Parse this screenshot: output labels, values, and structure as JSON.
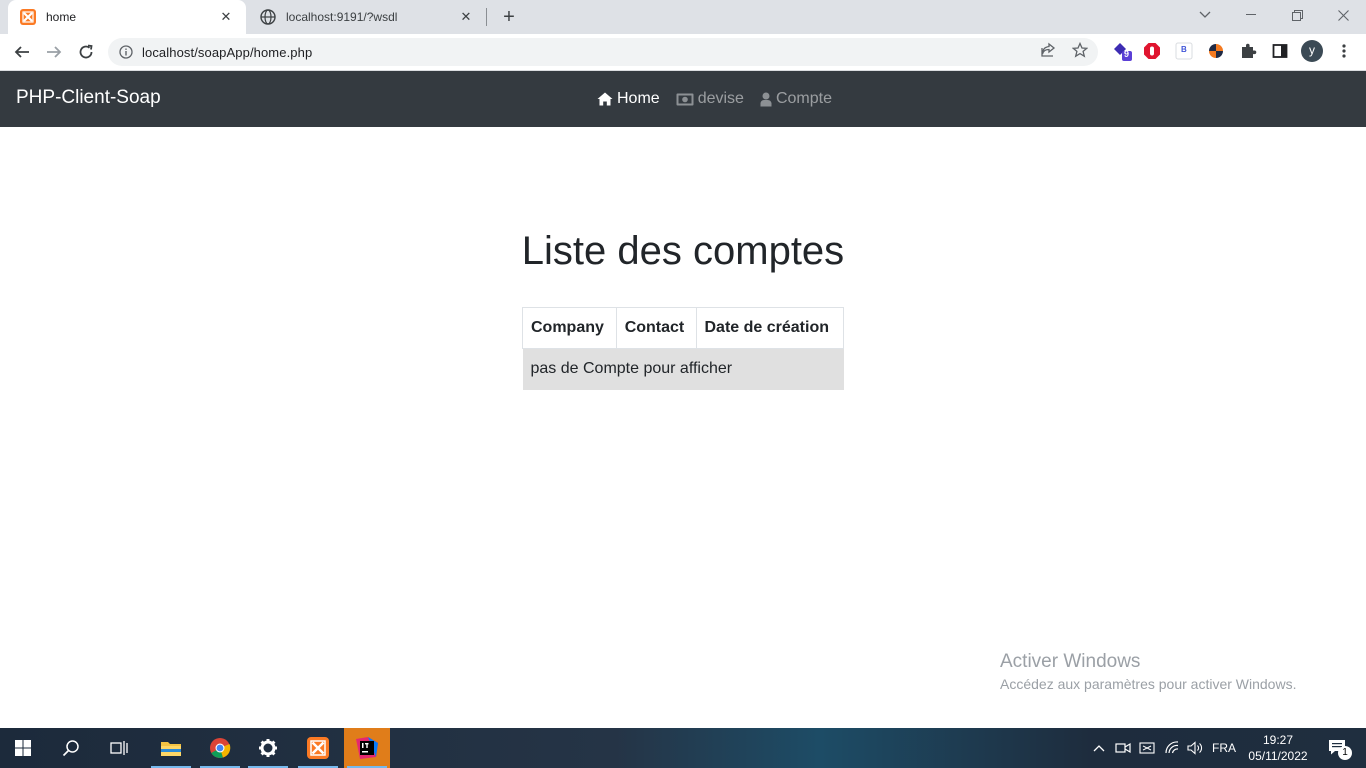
{
  "browser": {
    "tabs": [
      {
        "title": "home",
        "active": true
      },
      {
        "title": "localhost:9191/?wsdl",
        "active": false
      }
    ],
    "url": "localhost/soapApp/home.php",
    "profile_initial": "y",
    "extension_badge": "9",
    "extension_b_label": "B"
  },
  "navbar": {
    "brand": "PHP-Client-Soap",
    "links": [
      {
        "label": "Home",
        "icon": "home-icon",
        "active": true
      },
      {
        "label": "devise",
        "icon": "money-icon",
        "active": false
      },
      {
        "label": "Compte",
        "icon": "user-icon",
        "active": false
      }
    ]
  },
  "main": {
    "title": "Liste des comptes",
    "table": {
      "headers": [
        "Company",
        "Contact",
        "Date de création"
      ],
      "empty_message": "pas de Compte pour afficher"
    }
  },
  "watermark": {
    "title": "Activer Windows",
    "subtitle": "Accédez aux paramètres pour activer Windows."
  },
  "taskbar": {
    "apps": [
      "start-icon",
      "search-icon",
      "task-view-icon",
      "file-explorer-icon",
      "chrome-icon",
      "settings-icon",
      "xampp-icon",
      "intellij-icon"
    ],
    "language": "FRA",
    "time": "19:27",
    "date": "05/11/2022",
    "notifications": "1"
  },
  "colors": {
    "navbar_bg": "#343a40",
    "empty_row_bg": "#e0e0e0",
    "xampp_orange": "#fb7a24"
  }
}
